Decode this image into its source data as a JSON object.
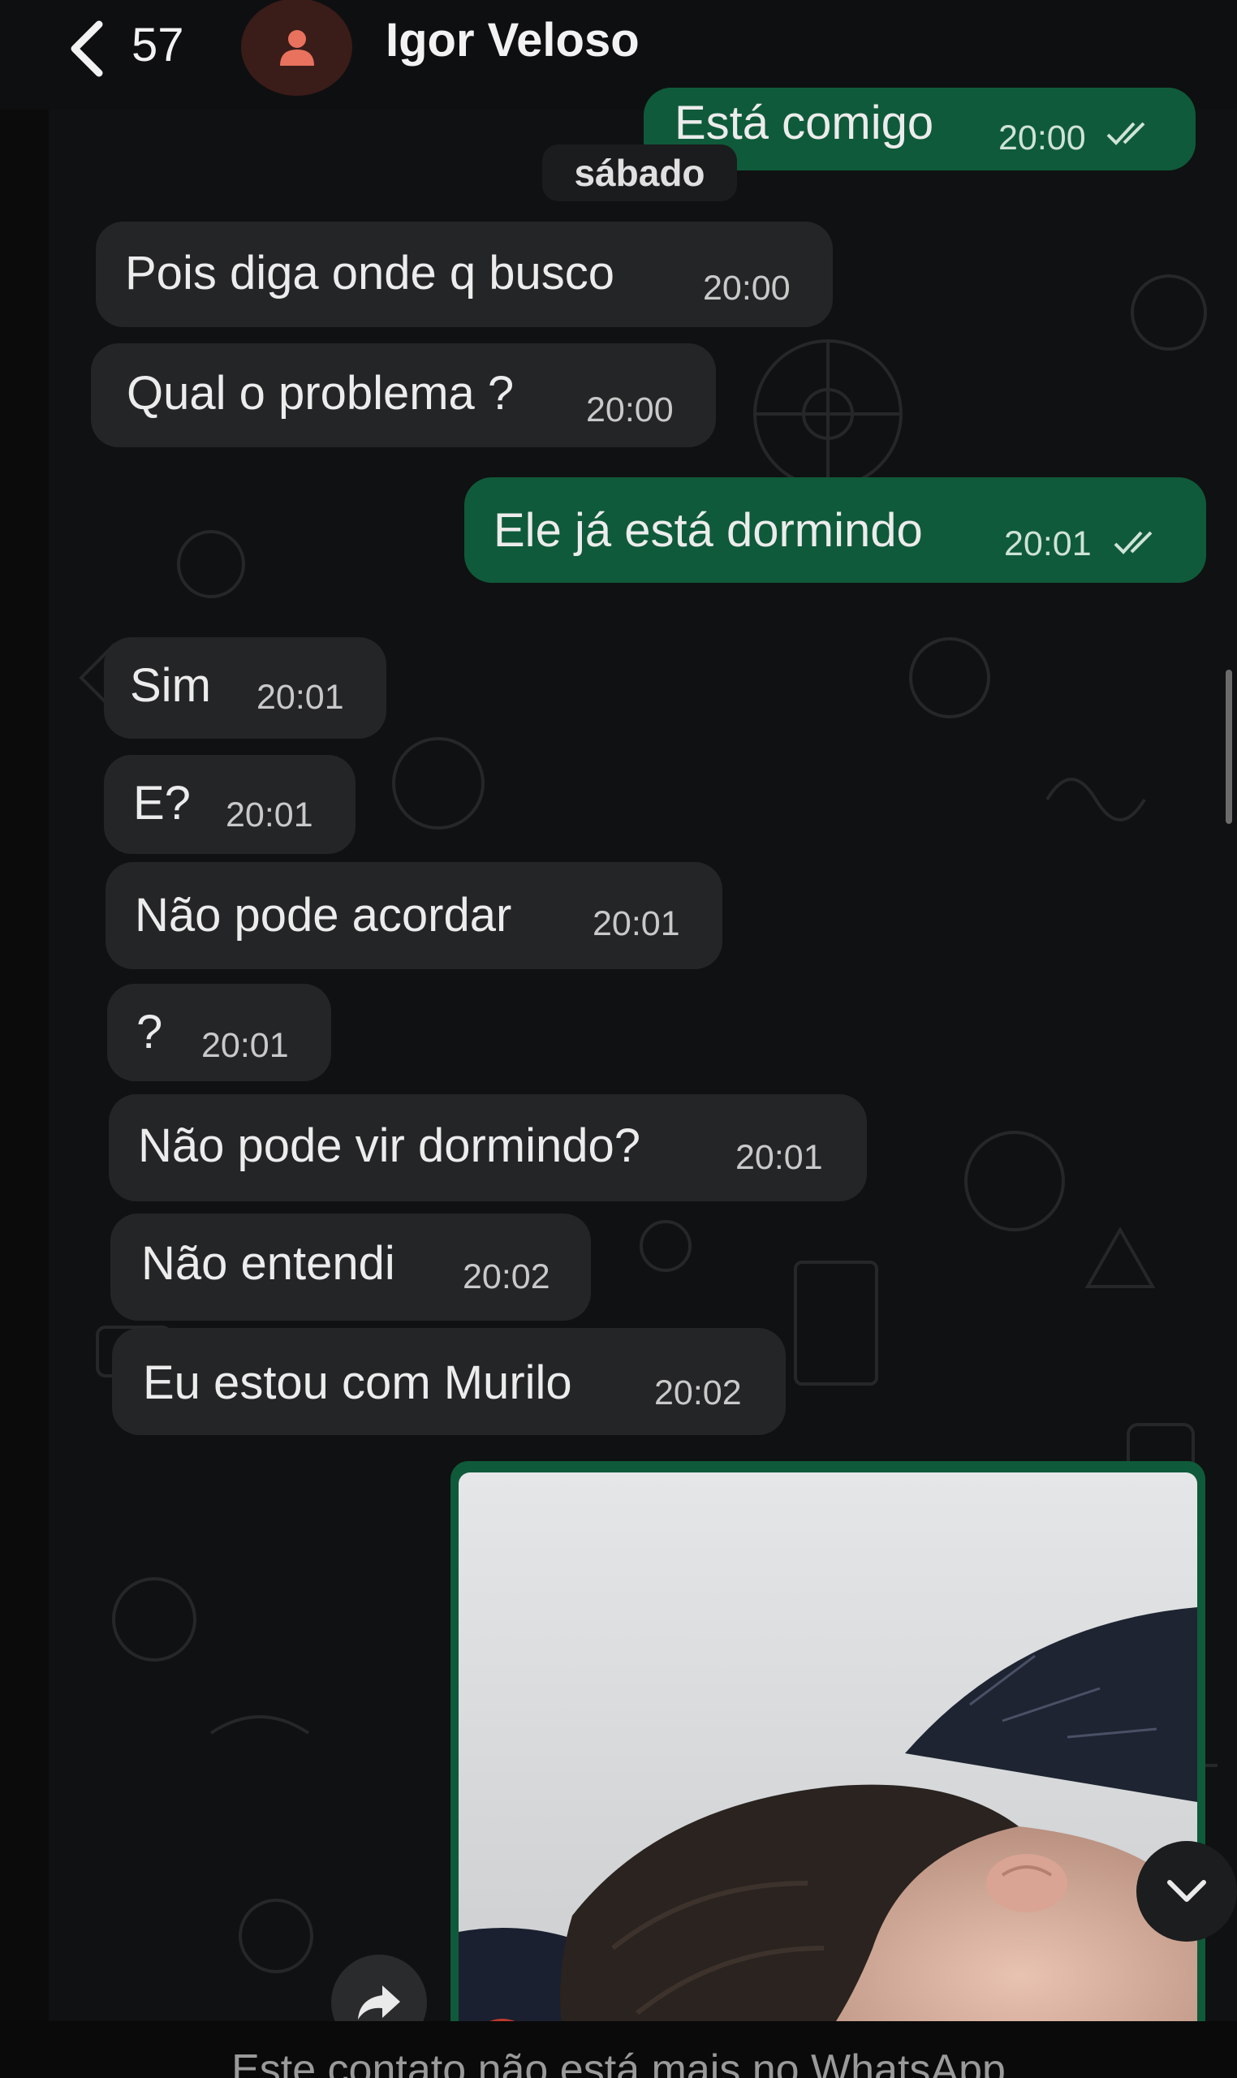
{
  "header": {
    "back_count": "57",
    "contact_name": "Igor Veloso"
  },
  "date_separator": "sábado",
  "messages": [
    {
      "direction": "out",
      "text": "Está comigo",
      "time": "20:00",
      "status": "read"
    },
    {
      "direction": "in",
      "text": "Pois diga onde q busco",
      "time": "20:00"
    },
    {
      "direction": "in",
      "text": "Qual o problema ?",
      "time": "20:00"
    },
    {
      "direction": "out",
      "text": "Ele já está dormindo",
      "time": "20:01",
      "status": "read"
    },
    {
      "direction": "in",
      "text": "Sim",
      "time": "20:01"
    },
    {
      "direction": "in",
      "text": "E?",
      "time": "20:01"
    },
    {
      "direction": "in",
      "text": "Não pode acordar",
      "time": "20:01"
    },
    {
      "direction": "in",
      "text": "?",
      "time": "20:01"
    },
    {
      "direction": "in",
      "text": "Não pode vir dormindo?",
      "time": "20:01"
    },
    {
      "direction": "in",
      "text": "Não entendi",
      "time": "20:02"
    },
    {
      "direction": "in",
      "text": "Eu estou com Murilo",
      "time": "20:02"
    }
  ],
  "photo_message": {
    "direction": "out",
    "content": "photo of a sleeping child"
  },
  "footer_notice": "Este contato não está mais no WhatsApp",
  "colors": {
    "incoming_bubble": "#242526",
    "outgoing_bubble": "#0f5a3a",
    "background": "#101112",
    "avatar_bg": "#3a1c19",
    "avatar_icon": "#e8725e"
  },
  "icons": [
    "chevron-left-icon",
    "person-icon",
    "double-check-icon",
    "chevron-down-icon",
    "forward-icon"
  ]
}
